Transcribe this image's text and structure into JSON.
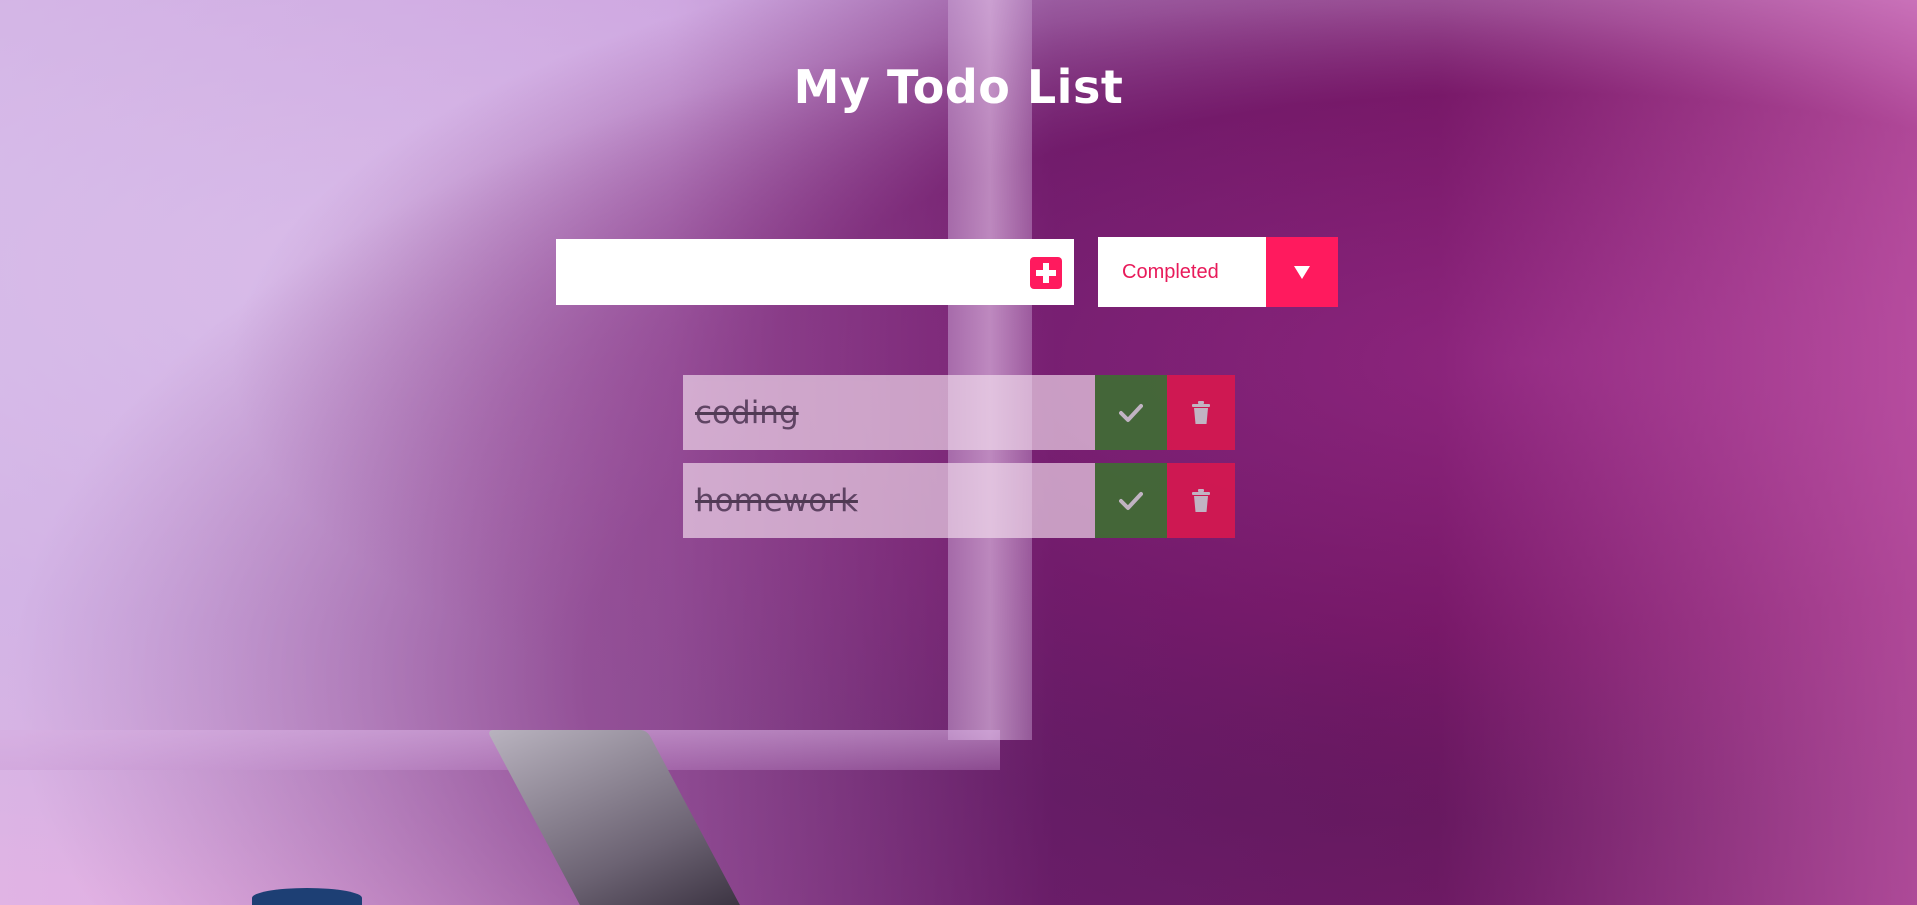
{
  "app": {
    "title": "My Todo List"
  },
  "form": {
    "input_value": "",
    "input_placeholder": "",
    "add_icon": "plus-square-icon",
    "filter": {
      "selected": "Completed",
      "arrow_icon": "caret-down-icon"
    }
  },
  "todos": [
    {
      "text": "coding",
      "completed": true
    },
    {
      "text": "homework",
      "completed": true
    }
  ],
  "icons": {
    "complete": "check-icon",
    "trash": "trash-icon"
  },
  "colors": {
    "accent": "#ff1a5e",
    "complete": "#3f6e33",
    "trash": "#d8184f",
    "title": "#ffffff"
  }
}
